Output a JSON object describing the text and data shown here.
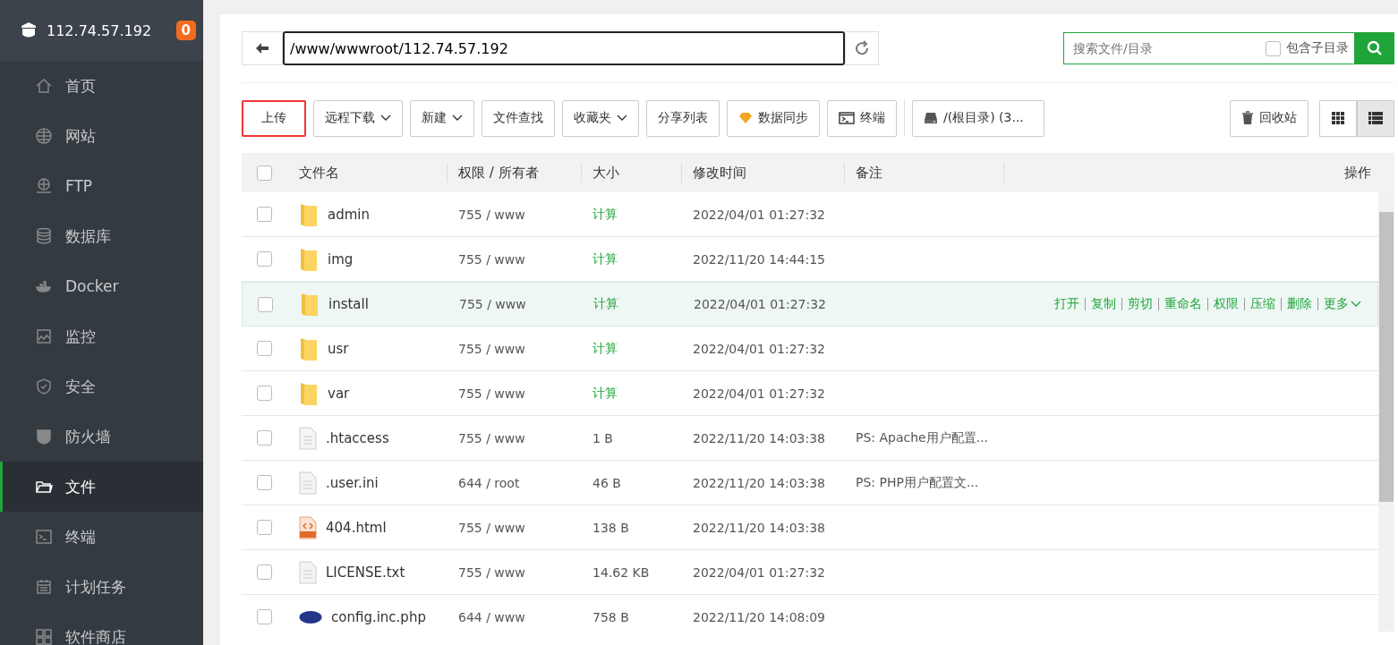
{
  "sidebar": {
    "server": "112.74.57.192",
    "badge": "0",
    "items": [
      {
        "label": "首页",
        "selected": false
      },
      {
        "label": "网站",
        "selected": false
      },
      {
        "label": "FTP",
        "selected": false
      },
      {
        "label": "数据库",
        "selected": false
      },
      {
        "label": "Docker",
        "selected": false
      },
      {
        "label": "监控",
        "selected": false
      },
      {
        "label": "安全",
        "selected": false
      },
      {
        "label": "防火墙",
        "selected": false
      },
      {
        "label": "文件",
        "selected": true
      },
      {
        "label": "终端",
        "selected": false
      },
      {
        "label": "计划任务",
        "selected": false
      },
      {
        "label": "软件商店",
        "selected": false
      }
    ]
  },
  "path_bar": {
    "path": "/www/wwwroot/112.74.57.192"
  },
  "search": {
    "placeholder": "搜索文件/目录",
    "include_subdirs_label": "包含子目录",
    "include_subdirs": false
  },
  "toolbar": {
    "buttons": [
      {
        "label": "上传",
        "kind": "plain",
        "highlighted": true
      },
      {
        "label": "远程下载",
        "kind": "dropdown",
        "highlighted": false
      },
      {
        "label": "新建",
        "kind": "dropdown",
        "highlighted": false
      },
      {
        "label": "文件查找",
        "kind": "plain",
        "highlighted": false
      },
      {
        "label": "收藏夹",
        "kind": "dropdown",
        "highlighted": false
      },
      {
        "label": "分享列表",
        "kind": "plain",
        "highlighted": false
      },
      {
        "label": "数据同步",
        "kind": "diamond",
        "highlighted": false
      },
      {
        "label": "终端",
        "kind": "terminal",
        "highlighted": false
      },
      {
        "label": "/(根目录) (3...",
        "kind": "disk",
        "highlighted": false
      }
    ],
    "recycle": "回收站",
    "views": [
      {
        "selected": false
      },
      {
        "selected": true
      }
    ]
  },
  "table": {
    "select_all": false,
    "columns": [
      "文件名",
      "权限 / 所有者",
      "大小",
      "修改时间",
      "备注",
      "操作"
    ],
    "rows": [
      {
        "kind": "folder",
        "name": "admin",
        "perm": "755 / www",
        "size": "计算",
        "mtime": "2022/04/01 01:27:32",
        "checked": false,
        "hovered": false
      },
      {
        "kind": "folder",
        "name": "img",
        "perm": "755 / www",
        "size": "计算",
        "mtime": "2022/11/20 14:44:15",
        "checked": false,
        "hovered": false
      },
      {
        "kind": "folder",
        "name": "install",
        "perm": "755 / www",
        "size": "计算",
        "mtime": "2022/04/01 01:27:32",
        "checked": false,
        "hovered": true,
        "actions": [
          "打开",
          "复制",
          "剪切",
          "重命名",
          "权限",
          "压缩",
          "删除",
          "更多"
        ]
      },
      {
        "kind": "folder",
        "name": "usr",
        "perm": "755 / www",
        "size": "计算",
        "mtime": "2022/04/01 01:27:32",
        "checked": false,
        "hovered": false
      },
      {
        "kind": "folder",
        "name": "var",
        "perm": "755 / www",
        "size": "计算",
        "mtime": "2022/04/01 01:27:32",
        "checked": false,
        "hovered": false
      },
      {
        "kind": "file",
        "name": ".htaccess",
        "perm": "755 / www",
        "size": "1 B",
        "mtime": "2022/11/20 14:03:38",
        "note": "PS: Apache用户配置...",
        "checked": false,
        "hovered": false
      },
      {
        "kind": "file",
        "name": ".user.ini",
        "perm": "644 / root",
        "size": "46 B",
        "mtime": "2022/11/20 14:03:38",
        "note": "PS: PHP用户配置文...",
        "checked": false,
        "hovered": false
      },
      {
        "kind": "html",
        "name": "404.html",
        "perm": "755 / www",
        "size": "138 B",
        "mtime": "2022/11/20 14:03:38",
        "checked": false,
        "hovered": false
      },
      {
        "kind": "file",
        "name": "LICENSE.txt",
        "perm": "755 / www",
        "size": "14.62 KB",
        "mtime": "2022/04/01 01:27:32",
        "checked": false,
        "hovered": false
      },
      {
        "kind": "php",
        "name": "config.inc.php",
        "perm": "644 / www",
        "size": "758 B",
        "mtime": "2022/11/20 14:08:09",
        "checked": false,
        "hovered": false
      }
    ]
  }
}
